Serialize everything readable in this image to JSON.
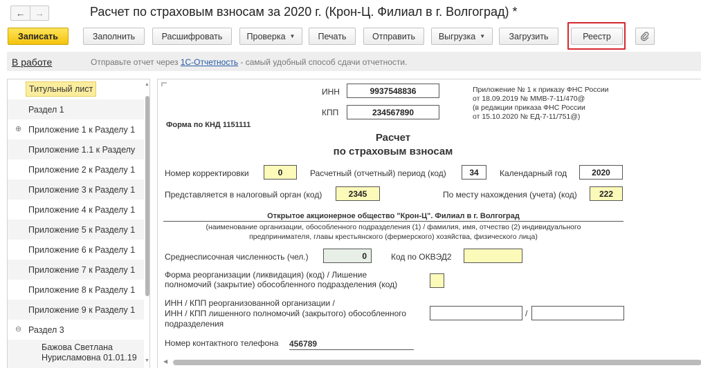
{
  "window": {
    "title": "Расчет по страховым взносам за 2020 г. (Крон-Ц. Филиал в г. Волгоград) *",
    "back_icon": "arrow-left-icon",
    "forward_icon": "arrow-right-icon"
  },
  "toolbar": {
    "save": "Записать",
    "fill": "Заполнить",
    "decode": "Расшифровать",
    "check": "Проверка",
    "print": "Печать",
    "send": "Отправить",
    "export": "Выгрузка",
    "import": "Загрузить",
    "registry": "Реестр",
    "attach_icon": "paperclip-icon"
  },
  "infobar": {
    "status": "В работе",
    "msg_before": "Отправьте отчет через ",
    "msg_link": "1С-Отчетность",
    "msg_after": " - самый удобный способ сдачи отчетности."
  },
  "sections": [
    "Титульный лист",
    "Раздел 1",
    "Приложение 1 к Разделу 1",
    "Приложение 1.1 к Разделу",
    "Приложение 2 к Разделу 1",
    "Приложение 3 к Разделу 1",
    "Приложение 4 к Разделу 1",
    "Приложение 5 к Разделу 1",
    "Приложение 6 к Разделу 1",
    "Приложение 7 к Разделу 1",
    "Приложение 8 к Разделу 1",
    "Приложение 9 к Разделу 1",
    "Раздел 3",
    "Бажова Светлана Нурисламовна 01.01.19"
  ],
  "expanders": {
    "collapsed": "⊕",
    "expanded": "⊖"
  },
  "form": {
    "inn_label": "ИНН",
    "inn": "9937548836",
    "kpp_label": "КПП",
    "kpp": "234567890",
    "appendix_note": [
      "Приложение № 1 к приказу ФНС России",
      "от 18.09.2019 № ММВ-7-11/470@",
      "(в редакции приказа ФНС России",
      "от 15.10.2020 № ЕД-7-11/751@)"
    ],
    "knd": "Форма по КНД 1151111",
    "heading1": "Расчет",
    "heading2": "по страховым взносам",
    "correction_label": "Номер корректировки",
    "correction": "0",
    "period_label": "Расчетный (отчетный) период (код)",
    "period": "34",
    "year_label": "Календарный год",
    "year": "2020",
    "tax_authority_label": "Представляется в налоговый орган (код)",
    "tax_authority": "2345",
    "location_label": "По месту нахождения (учета) (код)",
    "location": "222",
    "org_name": "Открытое акционерное общество \"Крон-Ц\". Филиал в г. Волгоград",
    "org_note1": "(наименование организации, обособленного подразделения (1) / фамилия, имя, отчество (2) индивидуального",
    "org_note2": "предпринимателя, главы крестьянского (фермерского) хозяйства, физического лица)",
    "headcount_label": "Среднесписочная численность (чел.)",
    "headcount": "0",
    "okved_label": "Код по ОКВЭД2",
    "okved": "",
    "reorg_label1": "Форма реорганизации (ликвидация) (код) / Лишение",
    "reorg_label2": "полномочий (закрытие) обособленного подразделения (код)",
    "reorg": "",
    "reorg_inn_label1": "ИНН / КПП реорганизованной организации /",
    "reorg_inn_label2": "ИНН / КПП лишенного полномочий (закрытого) обособленного",
    "reorg_inn_label3": "подразделения",
    "reorg_inn": "",
    "slash": "/",
    "reorg_kpp": "",
    "phone_label": "Номер контактного телефона",
    "phone": "456789"
  }
}
